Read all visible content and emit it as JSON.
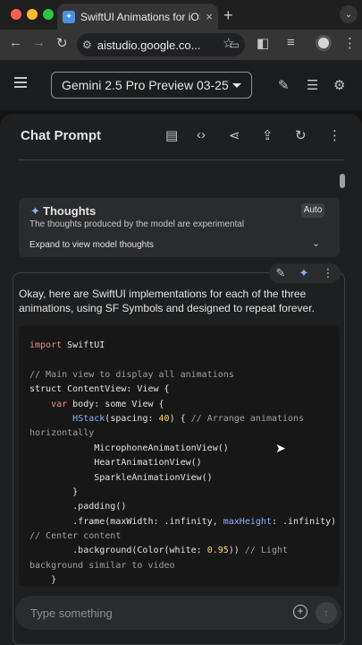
{
  "browser": {
    "tab_title": "SwiftUI Animations for iOS Ap",
    "tab_close": "×",
    "new_tab": "+",
    "url": "aistudio.google.co...",
    "traffic_colors": [
      "#ff5f57",
      "#febc2e",
      "#28c840"
    ]
  },
  "header": {
    "model": "Gemini 2.5 Pro Preview 03-25"
  },
  "panel": {
    "title": "Chat Prompt"
  },
  "thoughts": {
    "title": "Thoughts",
    "subtitle": "The thoughts produced by the model are experimental",
    "badge": "Auto",
    "expand": "Expand to view model thoughts"
  },
  "response": {
    "intro": "Okay, here are SwiftUI implementations for each of the three animations, using SF Symbols and designed to repeat forever.",
    "code": [
      "import SwiftUI",
      "",
      "// Main view to display all animations",
      "struct ContentView: View {",
      "    var body: some View {",
      "        HStack(spacing: 40) { // Arrange animations",
      "horizontally",
      "            MicrophoneAnimationView()",
      "            HeartAnimationView()",
      "            SparkleAnimationView()",
      "        }",
      "        .padding()",
      "        .frame(maxWidth: .infinity, maxHeight: .infinity)",
      "// Center content",
      "        .background(Color(white: 0.95)) // Light",
      "background similar to video",
      "    }"
    ]
  },
  "input": {
    "placeholder": "Type something"
  },
  "colors": {
    "accent": "#8ab4f8",
    "keyword": "#f28b82",
    "comment": "#9aa0a6",
    "number": "#fdd663"
  }
}
